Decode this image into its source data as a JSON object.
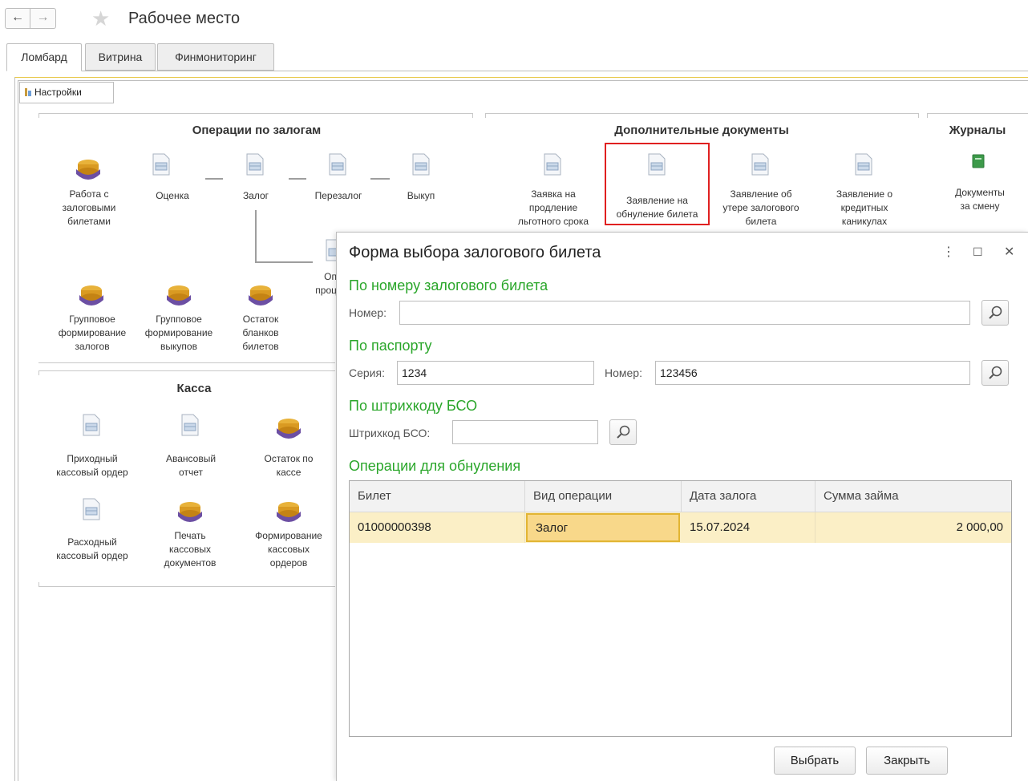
{
  "header": {
    "title": "Рабочее место",
    "back": "←",
    "forward": "→"
  },
  "tabs": [
    "Ломбард",
    "Витрина",
    "Финмониторинг"
  ],
  "settings_label": "Настройки",
  "groups": {
    "pledge_ops": "Операции по залогам",
    "extra_docs": "Дополнительные документы",
    "journals": "Журналы",
    "cash": "Касса"
  },
  "pledge_items": {
    "work_tickets": [
      "Работа с",
      "залоговыми",
      "билетами"
    ],
    "appraisal": "Оценка",
    "pledge": "Залог",
    "repledge": "Перезалог",
    "redemption": "Выкуп",
    "partial": [
      "Оп",
      "проц"
    ],
    "group_pledges": [
      "Групповое",
      "формирование",
      "залогов"
    ],
    "group_redemptions": [
      "Групповое",
      "формирование",
      "выкупов"
    ],
    "blank_balance": [
      "Остаток",
      "бланков",
      "билетов"
    ]
  },
  "extra_items": {
    "grace_period": [
      "Заявка на",
      "продление",
      "льготного срока"
    ],
    "reset_ticket": [
      "Заявление на",
      "обнуление билета"
    ],
    "lost_ticket": [
      "Заявление об",
      "утере залогового",
      "билета"
    ],
    "credit_holidays": [
      "Заявление о",
      "кредитных",
      "каникулах"
    ]
  },
  "journal_items": {
    "shift_docs": [
      "Документы",
      "за смену"
    ]
  },
  "cash_items": {
    "receipt_order": [
      "Приходный",
      "кассовый ордер"
    ],
    "advance_report": [
      "Авансовый",
      "отчет"
    ],
    "cash_balance": [
      "Остаток по",
      "кассе"
    ],
    "expense_order": [
      "Расходный",
      "кассовый ордер"
    ],
    "print_docs": [
      "Печать",
      "кассовых",
      "документов"
    ],
    "form_orders": [
      "Формирование",
      "кассовых",
      "ордеров"
    ]
  },
  "dialog": {
    "title": "Форма выбора залогового билета",
    "section_ticket": "По номеру залогового билета",
    "number_label": "Номер:",
    "number_value": "",
    "section_passport": "По паспорту",
    "series_label": "Серия:",
    "series_value": "1234",
    "passport_number_label": "Номер:",
    "passport_number_value": "123456",
    "section_barcode": "По штрихкоду БСО",
    "barcode_label": "Штрихкод БСО:",
    "barcode_value": "",
    "section_ops": "Операции для обнуления",
    "columns": [
      "Билет",
      "Вид операции",
      "Дата залога",
      "Сумма займа"
    ],
    "rows": [
      {
        "ticket": "01000000398",
        "operation": "Залог",
        "date": "15.07.2024",
        "amount": "2 000,00"
      }
    ],
    "select_btn": "Выбрать",
    "close_btn": "Закрыть"
  },
  "colors": {
    "section_green": "#2aa62a",
    "highlight_red": "#e02020",
    "row_selected": "#fbefc6"
  }
}
